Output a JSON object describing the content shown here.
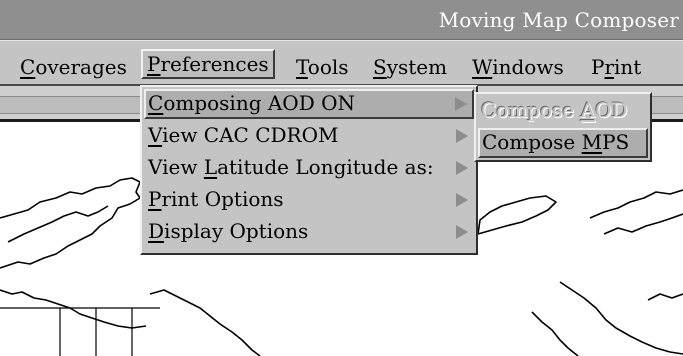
{
  "window": {
    "title": "Moving Map Composer"
  },
  "menubar": {
    "items": [
      {
        "label": "Coverages",
        "pre": "",
        "u": "C",
        "post": "overages"
      },
      {
        "label": "Preferences",
        "pre": "",
        "u": "P",
        "post": "references"
      },
      {
        "label": "Tools",
        "pre": "",
        "u": "T",
        "post": "ools"
      },
      {
        "label": "System",
        "pre": "",
        "u": "S",
        "post": "ystem"
      },
      {
        "label": "Windows",
        "pre": "",
        "u": "W",
        "post": "indows"
      },
      {
        "label": "Print",
        "pre": "P",
        "u": "r",
        "post": "int"
      }
    ],
    "active": "Preferences"
  },
  "preferences_menu": {
    "items": [
      {
        "label": "Composing AOD ON",
        "pre": "",
        "u": "C",
        "post": "omposing AOD ON",
        "has_submenu": true,
        "highlighted": true
      },
      {
        "label": "View CAC CDROM",
        "pre": "",
        "u": "V",
        "post": "iew CAC CDROM",
        "has_submenu": true
      },
      {
        "label": "View Latitude Longitude as:",
        "pre": "View ",
        "u": "L",
        "post": "atitude Longitude as:",
        "has_submenu": true
      },
      {
        "label": "Print Options",
        "pre": "",
        "u": "P",
        "post": "rint Options",
        "has_submenu": true
      },
      {
        "label": "Display Options",
        "pre": "",
        "u": "D",
        "post": "isplay Options",
        "has_submenu": true
      }
    ]
  },
  "submenu": {
    "items": [
      {
        "label": "Compose AOD",
        "pre": "Compose ",
        "u": "A",
        "post": "OD",
        "enabled": false
      },
      {
        "label": "Compose MPS",
        "pre": "Compose ",
        "u": "M",
        "post": "PS",
        "enabled": true,
        "highlighted": true
      }
    ]
  },
  "colors": {
    "titlebar": "#8f8f8f",
    "menubar": "#c4c4c4",
    "highlight": "#adadad",
    "map_background": "#ffffff",
    "coastline": "#000000"
  }
}
